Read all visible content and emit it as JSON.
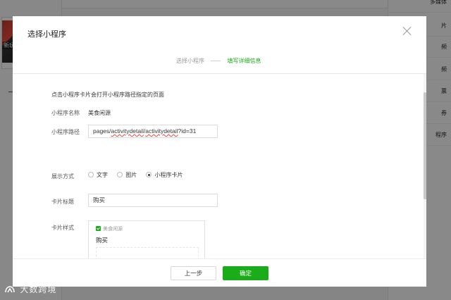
{
  "background": {
    "thumb_text": "新玩",
    "right_items": [
      "多媒体",
      "片",
      "频",
      "频",
      "票",
      "券",
      "程序"
    ],
    "watermark": "大数跨境"
  },
  "dialog": {
    "title": "选择小程序",
    "steps": [
      "选择小程序",
      "填写详细信息"
    ],
    "hint": "点击小程序卡片会打开小程序路径指定的页面",
    "name_label": "小程序名称",
    "name_value": "美食闲源",
    "path_label": "小程序路径",
    "path_value_parts": [
      "pages/",
      "activitydetail",
      "/",
      "activitydetail",
      "?id=31"
    ],
    "display_label": "展示方式",
    "display_options": [
      "文字",
      "图片",
      "小程序卡片"
    ],
    "display_selected": "小程序卡片",
    "card_title_label": "卡片标题",
    "card_title_value": "购买",
    "card_style_label": "卡片样式",
    "card_preview": {
      "app_name": "美食闲源",
      "title": "购买"
    },
    "buttons": {
      "prev": "上一步",
      "ok": "确定"
    }
  },
  "colors": {
    "accent": "#1aad19",
    "overlay": "rgba(0,0,0,0.45)"
  }
}
